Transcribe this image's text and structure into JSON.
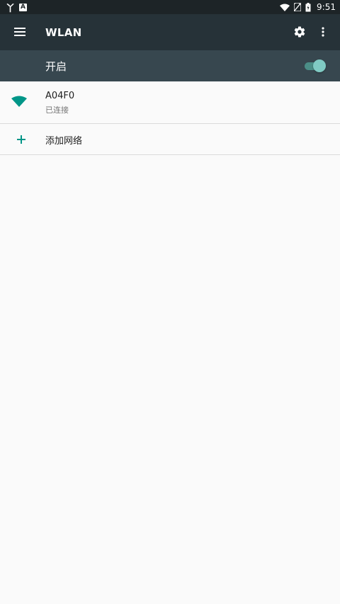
{
  "status_bar": {
    "time": "9:51",
    "notif_app_glyph": "丫",
    "notif_a_glyph": "A",
    "icons": [
      "wifi-signal-icon",
      "no-sim-icon",
      "battery-icon"
    ]
  },
  "toolbar": {
    "title": "WLAN",
    "icons": [
      "menu-icon",
      "gear-icon",
      "more-vert-icon"
    ]
  },
  "switch_bar": {
    "label": "开启",
    "enabled": true
  },
  "networks": [
    {
      "name": "A04F0",
      "status": "已连接",
      "icon": "wifi-icon"
    }
  ],
  "add_network": {
    "label": "添加网络",
    "icon": "plus-icon"
  },
  "colors": {
    "toolbar": "#263238",
    "switchbar": "#37474f",
    "statusbar": "#1d2427",
    "accent": "#009688",
    "toggle_thumb": "#80cbc4",
    "background": "#fafafa"
  }
}
